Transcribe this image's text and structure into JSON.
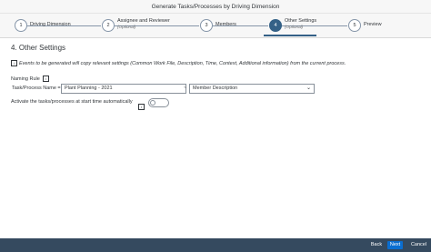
{
  "window": {
    "title": "Generate Tasks/Processes by Driving Dimension"
  },
  "wizard": {
    "steps": [
      {
        "number": "1",
        "label": "Driving Dimension",
        "sub": ""
      },
      {
        "number": "2",
        "label": "Assignee and Reviewer",
        "sub": "(Optional)"
      },
      {
        "number": "3",
        "label": "Members",
        "sub": ""
      },
      {
        "number": "4",
        "label": "Other Settings",
        "sub": "(Optional)",
        "active": true
      },
      {
        "number": "5",
        "label": "Preview",
        "sub": ""
      }
    ]
  },
  "main": {
    "section_title": "4. Other Settings",
    "info_text": "Events to be generated will copy relevant settings (Common Work File, Description, Time, Context, Additional information) from the current process.",
    "naming_rule_label": "Naming Rule",
    "task_name_label": "Task/Process Name =",
    "task_name_value": "Plant Planning - 2021",
    "separator": "~",
    "member_select_value": "Member Description",
    "activate_label": "Activate the tasks/processes at start time automatically",
    "activate_toggle_state": "off"
  },
  "footer": {
    "back_label": "Back",
    "next_label": "Next",
    "cancel_label": "Cancel"
  },
  "colors": {
    "accent": "#346187",
    "footer_bg": "#354a5f",
    "primary_button": "#0a6ed1"
  }
}
